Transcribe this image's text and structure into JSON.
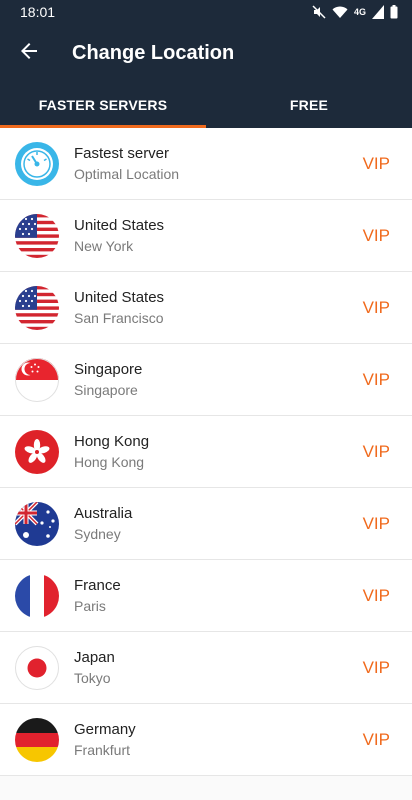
{
  "status_bar": {
    "time": "18:01",
    "network": "4G"
  },
  "app_bar": {
    "title": "Change Location"
  },
  "tabs": [
    {
      "label": "FASTER SERVERS",
      "active": true
    },
    {
      "label": "FREE",
      "active": false
    }
  ],
  "servers": [
    {
      "name": "Fastest server",
      "location": "Optimal Location",
      "badge": "VIP",
      "icon": "speedometer-icon"
    },
    {
      "name": "United States",
      "location": "New York",
      "badge": "VIP",
      "icon": "us-flag-icon"
    },
    {
      "name": "United States",
      "location": "San Francisco",
      "badge": "VIP",
      "icon": "us-flag-icon"
    },
    {
      "name": "Singapore",
      "location": "Singapore",
      "badge": "VIP",
      "icon": "singapore-flag-icon"
    },
    {
      "name": "Hong Kong",
      "location": "Hong Kong",
      "badge": "VIP",
      "icon": "hong-kong-flag-icon"
    },
    {
      "name": "Australia",
      "location": "Sydney",
      "badge": "VIP",
      "icon": "australia-flag-icon"
    },
    {
      "name": "France",
      "location": "Paris",
      "badge": "VIP",
      "icon": "france-flag-icon"
    },
    {
      "name": "Japan",
      "location": "Tokyo",
      "badge": "VIP",
      "icon": "japan-flag-icon"
    },
    {
      "name": "Germany",
      "location": "Frankfurt",
      "badge": "VIP",
      "icon": "germany-flag-icon"
    }
  ],
  "colors": {
    "header": "#1d2a3a",
    "accent": "#f06a1d"
  }
}
